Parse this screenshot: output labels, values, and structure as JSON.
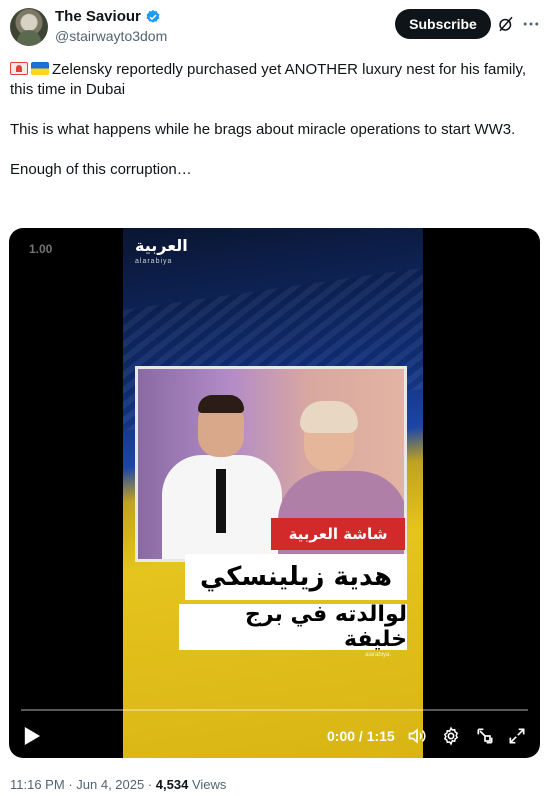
{
  "author": {
    "display_name": "The Saviour",
    "handle": "@stairwayto3dom",
    "verified": true
  },
  "actions": {
    "subscribe_label": "Subscribe",
    "grok_icon": "grok-icon",
    "more_icon": "more-icon"
  },
  "tweet": {
    "line1": "Zelensky reportedly purchased yet ANOTHER luxury nest for his family, this time in Dubai",
    "line2": "This is what happens while he brags about miracle operations to start WW3.",
    "line3": "Enough of this corruption…",
    "emojis": [
      "siren-emoji",
      "ukraine-flag-emoji"
    ]
  },
  "video": {
    "speed_label": "1.00",
    "logo_text": "العربية",
    "logo_sub": "alarabiya",
    "tag_text": "شاشة العربية",
    "title_line1": "هدية زيلينسكي",
    "title_line2": "لوالدته في برج خليفة",
    "watermark": "alarabiya.",
    "time_display": "0:00 / 1:15",
    "progress": 0,
    "colors": {
      "accent": "#1d9bf0",
      "tag_red": "#d22a2a",
      "flag_blue": "#1d45a8",
      "flag_yellow": "#e6c41e"
    }
  },
  "footer": {
    "time": "11:16 PM",
    "date": "Jun 4, 2025",
    "views_count": "4,534",
    "views_label": "Views"
  }
}
